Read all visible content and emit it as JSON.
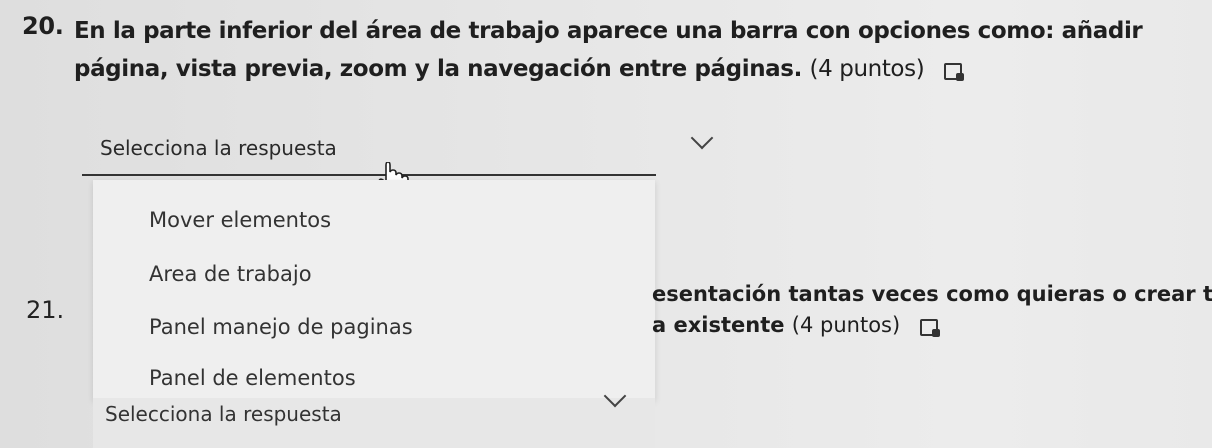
{
  "q20": {
    "number": "20.",
    "text": "En la parte inferior del área de trabajo aparece una barra con opciones como: añadir página, vista previa, zoom y la navegación entre páginas.",
    "points": "(4 puntos)"
  },
  "dropdown1": {
    "placeholder": "Selecciona la respuesta",
    "options": [
      "Mover elementos",
      "Area de trabajo",
      "Panel manejo de paginas",
      "Panel de elementos"
    ]
  },
  "q21": {
    "number": "21.",
    "text_line1": "esentación tantas veces como quieras o crear tu",
    "text_line2": "a existente",
    "points": "(4 puntos)"
  },
  "dropdown2": {
    "placeholder": "Selecciona la respuesta"
  }
}
